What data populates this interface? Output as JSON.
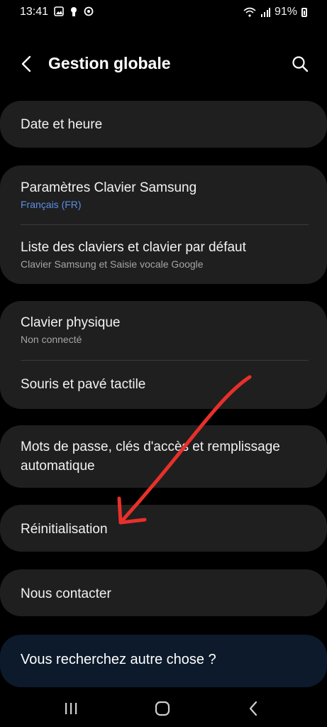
{
  "status_bar": {
    "time": "13:41",
    "battery": "91%",
    "icons": [
      "gallery-icon",
      "keyhole-icon",
      "shield-icon",
      "wifi-icon",
      "signal-icon",
      "battery-icon"
    ]
  },
  "header": {
    "title": "Gestion globale",
    "back_icon": "chevron-left-icon",
    "search_icon": "search-icon"
  },
  "groups": [
    {
      "items": [
        {
          "title": "Date et heure",
          "subtitle": ""
        }
      ]
    },
    {
      "items": [
        {
          "title": "Paramètres Clavier Samsung",
          "subtitle": "Français (FR)"
        },
        {
          "title": "Liste des claviers et clavier par défaut",
          "subtitle": "Clavier Samsung et Saisie vocale Google"
        }
      ]
    },
    {
      "items": [
        {
          "title": "Clavier physique",
          "subtitle": "Non connecté"
        },
        {
          "title": "Souris et pavé tactile",
          "subtitle": ""
        }
      ]
    },
    {
      "items": [
        {
          "title": "Mots de passe, clés d'accès et remplissage automatique",
          "subtitle": ""
        }
      ]
    },
    {
      "items": [
        {
          "title": "Réinitialisation",
          "subtitle": ""
        }
      ]
    },
    {
      "items": [
        {
          "title": "Nous contacter",
          "subtitle": ""
        }
      ]
    }
  ],
  "search_card": {
    "label": "Vous recherchez autre chose ?"
  },
  "nav_bar": {
    "icons": [
      "recent-apps-icon",
      "home-icon",
      "back-icon"
    ]
  },
  "annotation": {
    "color": "#e8302a",
    "target": "Réinitialisation"
  }
}
